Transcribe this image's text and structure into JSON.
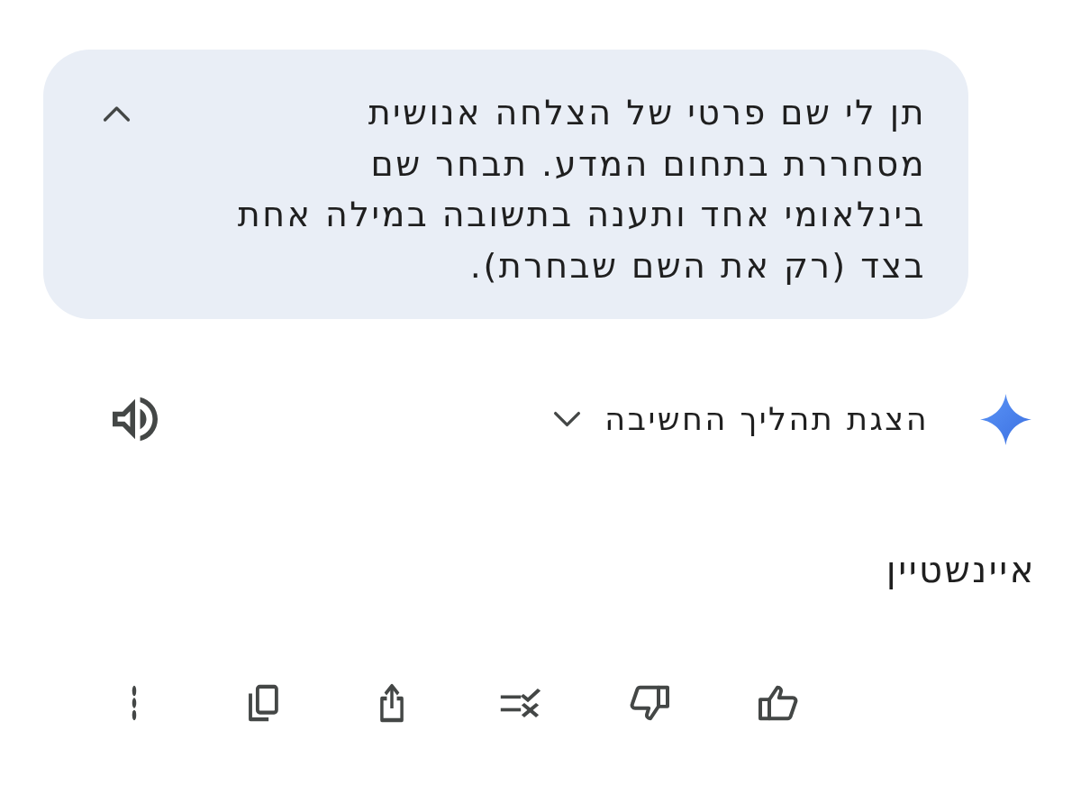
{
  "prompt": {
    "text": "תן לי שם פרטי של הצלחה אנושית מסחררת בתחום המדע. תבחר שם בינלאומי אחד ותענה בתשובה במילה אחת בצד (רק את השם שבחרת).",
    "expanded": true
  },
  "response": {
    "thinking": {
      "label": "הצגת תהליך החשיבה",
      "expanded": false
    },
    "answer": "איינשטיין"
  },
  "actions": [
    {
      "kind": "like"
    },
    {
      "kind": "dislike"
    },
    {
      "kind": "double-check"
    },
    {
      "kind": "share"
    },
    {
      "kind": "copy"
    },
    {
      "kind": "more"
    }
  ]
}
